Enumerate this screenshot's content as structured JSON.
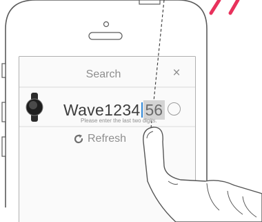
{
  "dialog": {
    "title": "Search",
    "close_glyph": "×",
    "device_prefix": "Wave1234",
    "digits_value": "56",
    "hint": "Please enter the last two digits.",
    "refresh_label": "Refresh"
  },
  "icons": {
    "close": "close-icon",
    "refresh": "refresh-icon",
    "device": "smartwatch-icon"
  },
  "colors": {
    "accent_marks": "#e8325c",
    "cursor": "#2f87d8",
    "text_dark": "#3d3d3d",
    "text_muted": "#8e8e8e",
    "phone_outline": "#5a5a5a"
  }
}
